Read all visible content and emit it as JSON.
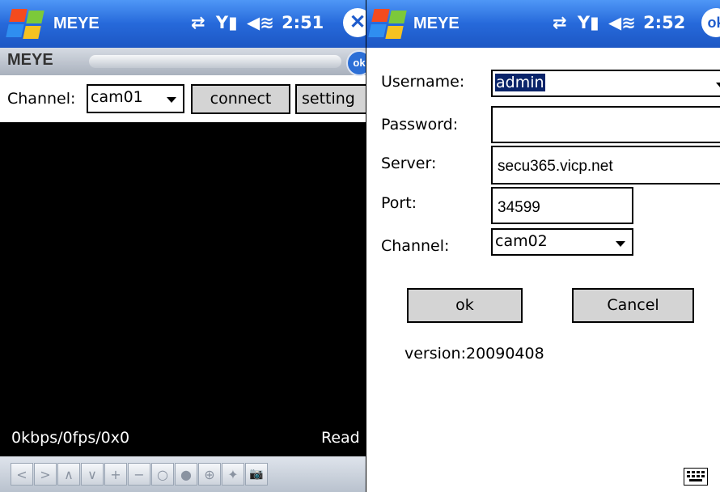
{
  "left": {
    "titlebar": {
      "app_title": "MEYE",
      "time": "2:51"
    },
    "menubar": {
      "label": "MEYE",
      "ok_label": "ok"
    },
    "controls": {
      "channel_label": "Channel:",
      "channel_value": "cam01",
      "connect_label": "connect",
      "setting_label": "setting"
    },
    "status": {
      "stats": "0kbps/0fps/0x0",
      "state": "Read"
    },
    "toolbar": [
      {
        "name": "pan-left-button",
        "glyph": "<"
      },
      {
        "name": "pan-right-button",
        "glyph": ">"
      },
      {
        "name": "tilt-up-button",
        "glyph": "∧"
      },
      {
        "name": "tilt-down-button",
        "glyph": "∨"
      },
      {
        "name": "zoom-in-button",
        "glyph": "+"
      },
      {
        "name": "zoom-out-button",
        "glyph": "−"
      },
      {
        "name": "focus-near-button",
        "glyph": "○"
      },
      {
        "name": "focus-far-button",
        "glyph": "●"
      },
      {
        "name": "iris-button",
        "glyph": "⊕"
      },
      {
        "name": "preset-button",
        "glyph": "✦"
      },
      {
        "name": "snapshot-button",
        "glyph": "📷"
      }
    ]
  },
  "right": {
    "titlebar": {
      "app_title": "MEYE",
      "time": "2:52",
      "ok_label": "ok"
    },
    "form": {
      "username_label": "Username:",
      "username_value": "admin",
      "password_label": "Password:",
      "password_value": "",
      "server_label": "Server:",
      "server_value": "secu365.vicp.net",
      "port_label": "Port:",
      "port_value": "34599",
      "channel_label": "Channel:",
      "channel_value": "cam02"
    },
    "buttons": {
      "ok_label": "ok",
      "cancel_label": "Cancel"
    },
    "version": "version:20090408"
  },
  "icons": {
    "windows_logo": "windows-logo-icon",
    "connectivity": "sync-arrows-icon",
    "signal": "signal-icon",
    "volume": "speaker-icon",
    "close": "close-icon",
    "keyboard": "keyboard-icon"
  },
  "colors": {
    "titlebar": "#2669da",
    "selection": "#0a246a",
    "video_bg": "#000000"
  }
}
